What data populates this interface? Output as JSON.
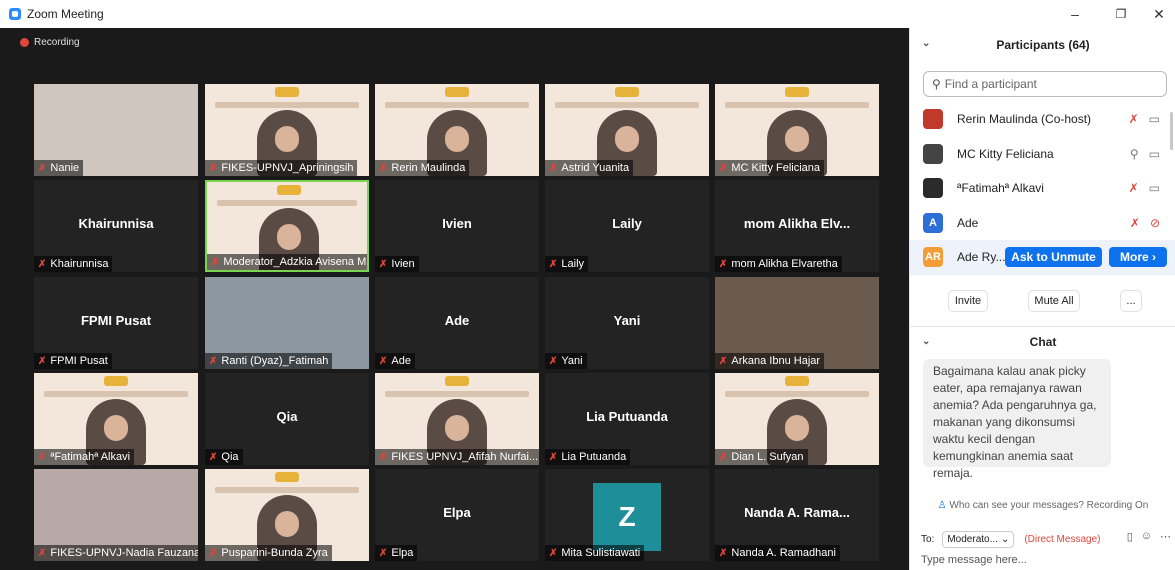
{
  "window": {
    "title": "Zoom Meeting",
    "minimize": "–",
    "restore": "❐",
    "close": "✕"
  },
  "recording": "Recording",
  "tiles": [
    {
      "name": "Nanie",
      "center": "",
      "kind": "cam",
      "bg": "#cfc6c0"
    },
    {
      "name": "FIKES-UPNVJ_Apriningsih",
      "center": "",
      "kind": "slide"
    },
    {
      "name": "Rerin Maulinda",
      "center": "",
      "kind": "slide"
    },
    {
      "name": "Astrid Yuanita",
      "center": "",
      "kind": "slide"
    },
    {
      "name": "MC Kitty Feliciana",
      "center": "",
      "kind": "slide"
    },
    {
      "name": "Khairunnisa",
      "center": "Khairunnisa",
      "kind": "name"
    },
    {
      "name": "Moderator_Adzkia Avisena M...",
      "center": "",
      "kind": "slide",
      "active": true
    },
    {
      "name": "Ivien",
      "center": "Ivien",
      "kind": "name"
    },
    {
      "name": "Laily",
      "center": "Laily",
      "kind": "name"
    },
    {
      "name": "mom Alikha Elvaretha",
      "center": "mom Alikha Elv...",
      "kind": "name"
    },
    {
      "name": "FPMI Pusat",
      "center": "FPMI Pusat",
      "kind": "name"
    },
    {
      "name": "Ranti (Dyaz)_Fatimah",
      "center": "",
      "kind": "cam",
      "bg": "#8d97a0"
    },
    {
      "name": "Ade",
      "center": "Ade",
      "kind": "name"
    },
    {
      "name": "Yani",
      "center": "Yani",
      "kind": "name"
    },
    {
      "name": "Arkana Ibnu Hajar",
      "center": "",
      "kind": "cam",
      "bg": "#6b5a4e"
    },
    {
      "name": "ªFatimahª Alkavi",
      "center": "",
      "kind": "slide"
    },
    {
      "name": "Qia",
      "center": "Qia",
      "kind": "name"
    },
    {
      "name": "FIKES UPNVJ_Afifah Nurfai...",
      "center": "",
      "kind": "slide"
    },
    {
      "name": "Lia Putuanda",
      "center": "Lia Putuanda",
      "kind": "name"
    },
    {
      "name": "Dian L. Sufyan",
      "center": "",
      "kind": "slide"
    },
    {
      "name": "FIKES-UPNVJ-Nadia Fauzana",
      "center": "",
      "kind": "cam",
      "bg": "#b9a9a6"
    },
    {
      "name": "Pusparini-Bunda Zyra",
      "center": "",
      "kind": "slide"
    },
    {
      "name": "Elpa",
      "center": "Elpa",
      "kind": "name"
    },
    {
      "name": "Mita Sulistiawati",
      "center": "",
      "kind": "avatar",
      "letter": "Z"
    },
    {
      "name": "Nanda A. Ramadhani",
      "center": "Nanda A. Rama...",
      "kind": "name"
    }
  ],
  "panel": {
    "participants_title": "Participants (64)",
    "search_placeholder": "Find a participant",
    "participants": [
      {
        "name": "Rerin Maulinda (Co-host)",
        "avatar": "",
        "color": "#c0392b",
        "mic": "off",
        "cam": "on"
      },
      {
        "name": "MC Kitty Feliciana",
        "avatar": "",
        "color": "#444444",
        "mic": "on",
        "cam": "on"
      },
      {
        "name": "ªFatimahª Alkavi",
        "avatar": "",
        "color": "#2b2b2b",
        "mic": "off",
        "cam": "on"
      },
      {
        "name": "Ade",
        "avatar": "A",
        "color": "#2d6fd6",
        "mic": "off",
        "cam": "off"
      },
      {
        "name": "Ade Ry...",
        "avatar": "AR",
        "color": "#f29d38",
        "mic": "",
        "cam": ""
      }
    ],
    "ask_to_unmute": "Ask to Unmute",
    "more": "More ›",
    "invite": "Invite",
    "mute_all": "Mute All",
    "ellipsis": "...",
    "chat_title": "Chat",
    "chat_message": "Bagaimana kalau anak picky eater, apa remajanya rawan anemia? Ada pengaruhnya ga, makanan yang dikonsumsi waktu kecil dengan kemungkinan anemia saat remaja.",
    "privacy": "Who can see your messages? Recording On",
    "to_label": "To:",
    "to_value": "Moderato...",
    "direct": "(Direct Message)",
    "input_placeholder": "Type message here..."
  }
}
